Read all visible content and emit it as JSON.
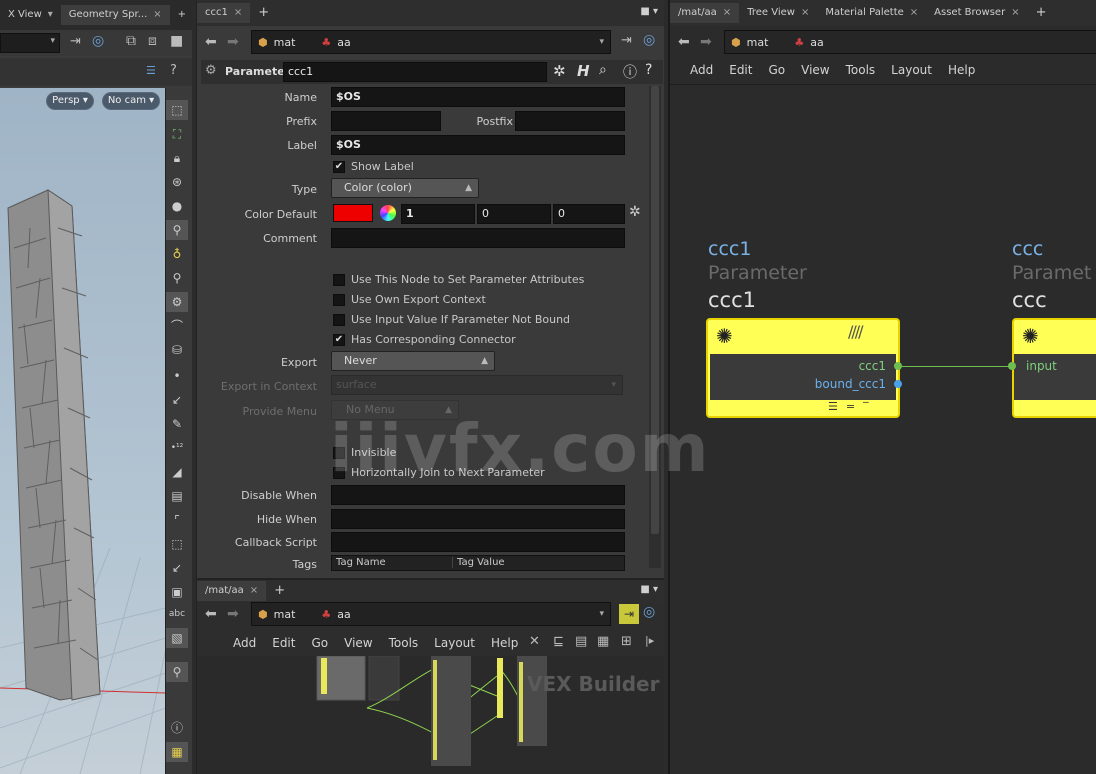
{
  "left": {
    "tabs": [
      {
        "label": "X View"
      },
      {
        "label": "Geometry Spr..."
      }
    ],
    "view_persp": "Persp ▾",
    "view_cam": "No cam ▾",
    "toolbar_abc": "abc"
  },
  "center": {
    "tab_label": "ccc1",
    "path": {
      "network": "mat",
      "node": "aa"
    },
    "header": {
      "type_label": "Parameter",
      "node_name": "ccc1"
    },
    "params": {
      "name": {
        "label": "Name",
        "value": "$OS"
      },
      "prefix": {
        "label": "Prefix",
        "value": ""
      },
      "postfix": {
        "label": "Postfix",
        "value": ""
      },
      "label_field": {
        "label": "Label",
        "value": "$OS"
      },
      "show_label": {
        "label": "Show Label",
        "checked": true
      },
      "type": {
        "label": "Type",
        "value": "Color (color)"
      },
      "color_default": {
        "label": "Color Default",
        "color": "#ee0000",
        "r": "1",
        "g": "0",
        "b": "0"
      },
      "comment": {
        "label": "Comment",
        "value": ""
      },
      "checks": [
        {
          "label": "Use This Node to Set Parameter Attributes",
          "checked": false
        },
        {
          "label": "Use Own Export Context",
          "checked": false
        },
        {
          "label": "Use Input Value If Parameter Not Bound",
          "checked": false
        },
        {
          "label": "Has Corresponding Connector",
          "checked": true
        }
      ],
      "export": {
        "label": "Export",
        "value": "Never"
      },
      "export_context": {
        "label": "Export in Context",
        "value": "surface"
      },
      "provide_menu": {
        "label": "Provide Menu",
        "value": "No Menu"
      },
      "invisible": {
        "label": "Invisible",
        "checked": false
      },
      "hjoin": {
        "label": "Horizontally Join to Next Parameter",
        "checked": false
      },
      "disable_when": {
        "label": "Disable When",
        "value": ""
      },
      "hide_when": {
        "label": "Hide When",
        "value": ""
      },
      "callback": {
        "label": "Callback Script",
        "value": ""
      },
      "tags": {
        "label": "Tags",
        "col1": "Tag Name",
        "col2": "Tag Value"
      }
    }
  },
  "bottom": {
    "tab_label": "/mat/aa",
    "path": {
      "network": "mat",
      "node": "aa"
    },
    "menu": [
      "Add",
      "Edit",
      "Go",
      "View",
      "Tools",
      "Layout",
      "Help"
    ],
    "watermark": "VEX Builder"
  },
  "right": {
    "tabs": [
      {
        "label": "/mat/aa"
      },
      {
        "label": "Tree View"
      },
      {
        "label": "Material Palette"
      },
      {
        "label": "Asset Browser"
      }
    ],
    "path": {
      "network": "mat",
      "node": "aa"
    },
    "menu": [
      "Add",
      "Edit",
      "Go",
      "View",
      "Tools",
      "Layout",
      "Help"
    ],
    "node1": {
      "name": "ccc1",
      "type": "Parameter",
      "label": "ccc1",
      "out1": "ccc1",
      "out2": "bound_ccc1"
    },
    "node2": {
      "name": "ccc",
      "type": "Paramet",
      "label": "ccc",
      "in1": "input"
    },
    "wire_color": "#6fbf4f",
    "node_color": "#ffff55"
  },
  "watermark": "iiivfx.com"
}
